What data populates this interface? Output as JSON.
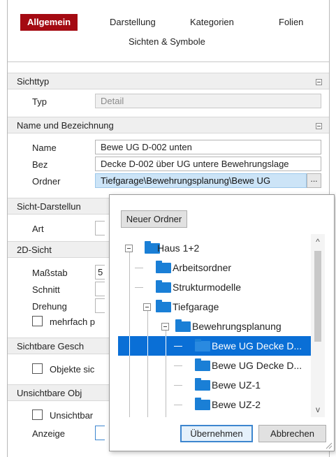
{
  "tabs": [
    {
      "label": "Allgemein",
      "active": true
    },
    {
      "label": "Darstellung"
    },
    {
      "label": "Kategorien"
    },
    {
      "label": "Folien"
    },
    {
      "label": "Sichten & Symbole"
    }
  ],
  "sections": {
    "sichttyp": {
      "title": "Sichttyp",
      "typ_label": "Typ",
      "typ_value": "Detail"
    },
    "name": {
      "title": "Name und Bezeichnung",
      "name_label": "Name",
      "name_value": "Bewe UG D-002 unten",
      "bez_label": "Bez",
      "bez_value": "Decke D-002 über UG untere Bewehrungslage",
      "ordner_label": "Ordner",
      "ordner_value": "Tiefgarage\\Bewehrungsplanung\\Bewe UG",
      "ordner_button": "..."
    },
    "darstellung": {
      "title": "Sicht-Darstellun",
      "art_label": "Art"
    },
    "sicht2d": {
      "title": "2D-Sicht",
      "massstab_label": "Maßstab",
      "massstab_partial": "5",
      "schnitt_label": "Schnitt",
      "drehung_label": "Drehung",
      "mehrfach_label": "mehrfach p"
    },
    "sichtbare": {
      "title": "Sichtbare Gesch",
      "objekte_label": "Objekte sic"
    },
    "unsichtbare": {
      "title": "Unsichtbare Obj",
      "unsichtbar_label": "Unsichtbar",
      "anzeige_label": "Anzeige"
    }
  },
  "popup": {
    "new_folder_button": "Neuer Ordner",
    "tree": [
      {
        "label": "Haus 1+2",
        "level": 0,
        "expanded": true
      },
      {
        "label": "Arbeitsordner",
        "level": 1
      },
      {
        "label": "Strukturmodelle",
        "level": 1
      },
      {
        "label": "Tiefgarage",
        "level": 1,
        "expanded": true
      },
      {
        "label": "Bewehrungsplanung",
        "level": 2,
        "expanded": true
      },
      {
        "label": "Bewe UG Decke D...",
        "level": 3,
        "selected": true
      },
      {
        "label": "Bewe UG Decke D...",
        "level": 3
      },
      {
        "label": "Bewe UZ-1",
        "level": 3
      },
      {
        "label": "Bewe UZ-2",
        "level": 3
      }
    ],
    "ok_button": "Übernehmen",
    "cancel_button": "Abbrechen"
  },
  "colors": {
    "active_tab": "#a40a12",
    "selection": "#0a6fd6",
    "folder": "#1a7fd6",
    "field_highlight": "#cce4f7"
  }
}
